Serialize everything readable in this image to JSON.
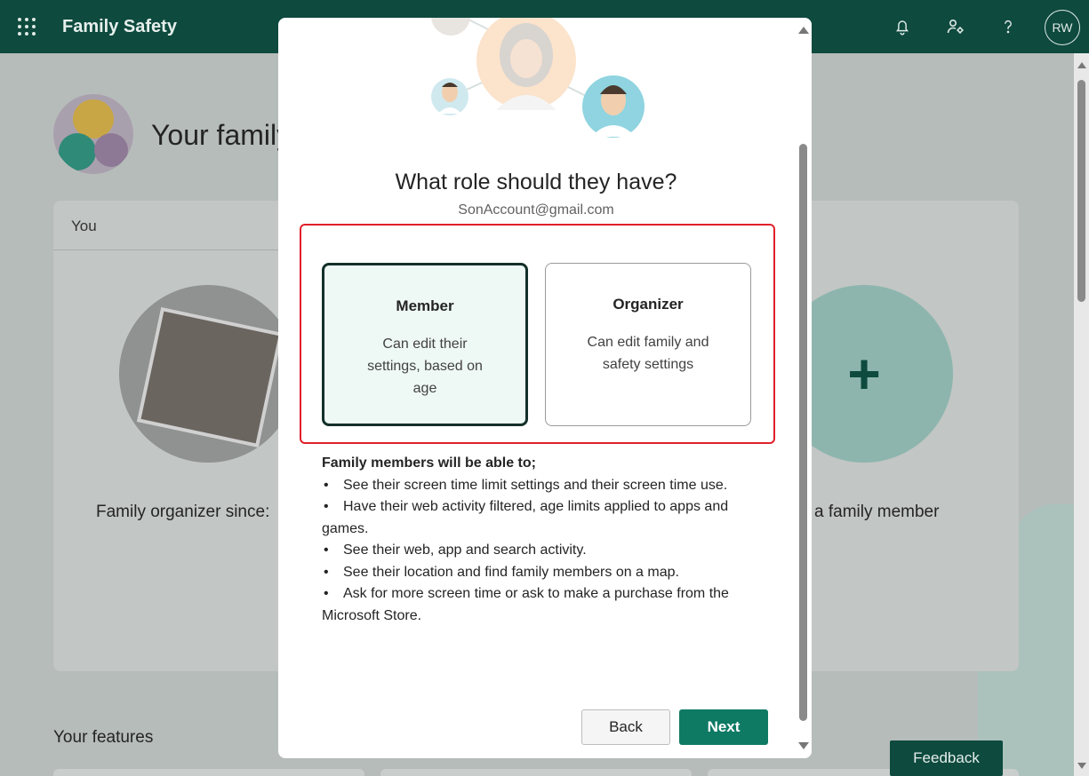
{
  "app": {
    "title": "Family Safety",
    "avatar_initials": "RW"
  },
  "topbar_icons": [
    "bell-icon",
    "people-settings-icon",
    "help-icon"
  ],
  "background": {
    "family_heading": "Your family",
    "you_tab": "You",
    "organizer_since": "Family organizer since:",
    "add_member": "a family member",
    "features_title": "Your features",
    "feedback_label": "Feedback"
  },
  "dialog": {
    "title": "What role should they have?",
    "email": "SonAccount@gmail.com",
    "roles": [
      {
        "title": "Member",
        "description": "Can edit their settings, based on age",
        "selected": true
      },
      {
        "title": "Organizer",
        "description": "Can edit family and safety settings",
        "selected": false
      }
    ],
    "abilities_heading": "Family members will be able to;",
    "abilities": [
      "See their screen time limit settings and their screen time use.",
      "Have their web activity filtered, age limits applied to apps and games.",
      "See their web, app and search activity.",
      "See their location and find family members on a map.",
      "Ask for more screen time or ask to make a purchase from the Microsoft Store."
    ],
    "back_label": "Back",
    "next_label": "Next"
  },
  "colors": {
    "brand": "#0e4a3e",
    "primary_button": "#0e7a64",
    "highlight": "#e0202a",
    "selected_card_bg": "#eef8f5"
  }
}
